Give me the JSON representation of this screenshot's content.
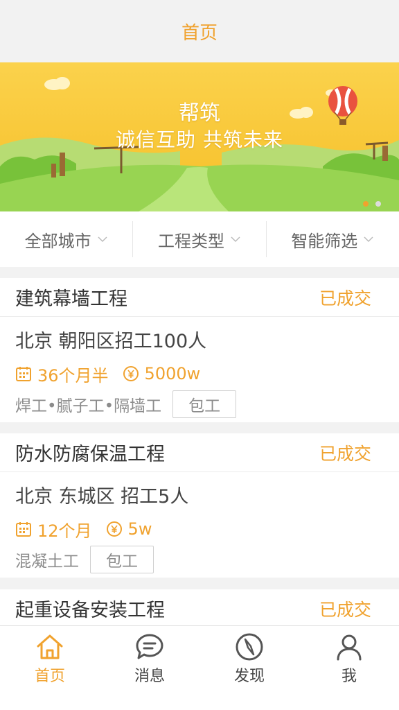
{
  "header": {
    "title": "首页"
  },
  "banner": {
    "title": "帮筑",
    "slogan": "诚信互助 共筑未来",
    "colors": {
      "sky_top": "#fbd04a",
      "sky_bottom": "#f7c32a",
      "grass": "#8fcf4a"
    }
  },
  "filters": [
    {
      "label": "全部城市"
    },
    {
      "label": "工程类型"
    },
    {
      "label": "智能筛选"
    }
  ],
  "projects": [
    {
      "title": "建筑幕墙工程",
      "status": "已成交",
      "location": "北京 朝阳区招工100人",
      "duration": "36个月半",
      "budget": "5000w",
      "trades": "焊工•腻子工•隔墙工",
      "badge": "包工"
    },
    {
      "title": "防水防腐保温工程",
      "status": "已成交",
      "location": "北京 东城区 招工5人",
      "duration": "12个月",
      "budget": "5w",
      "trades": "混凝土工",
      "badge": "包工"
    },
    {
      "title": "起重设备安装工程",
      "status": "已成交"
    }
  ],
  "tabs": [
    {
      "label": "首页",
      "icon": "home-icon",
      "active": true
    },
    {
      "label": "消息",
      "icon": "message-icon",
      "active": false
    },
    {
      "label": "发现",
      "icon": "compass-icon",
      "active": false
    },
    {
      "label": "我",
      "icon": "user-icon",
      "active": false
    }
  ],
  "accent_color": "#f0a22e"
}
